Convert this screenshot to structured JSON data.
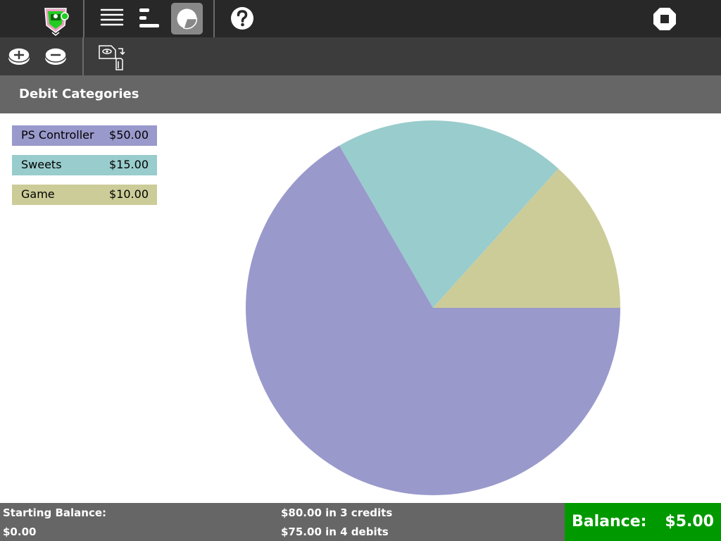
{
  "toolbar": {
    "icons": [
      "activity-icon",
      "list-view-icon",
      "bar-chart-icon",
      "pie-chart-icon",
      "help-icon",
      "stop-icon"
    ],
    "active": "pie-chart-icon"
  },
  "subbar": {
    "icons": [
      "add-credit-icon",
      "add-debit-icon",
      "view-copy-icon"
    ]
  },
  "header": {
    "title": "Debit Categories"
  },
  "colors": {
    "toolbar": "#282828",
    "subbar": "#3c3c3c",
    "header": "#666666",
    "balance": "#009900"
  },
  "chart_data": {
    "type": "pie",
    "categories": [
      "PS Controller",
      "Sweets",
      "Game"
    ],
    "values": [
      50,
      15,
      10
    ],
    "labels": [
      "$50.00",
      "$15.00",
      "$10.00"
    ],
    "colors": [
      "#9999cc",
      "#99cccc",
      "#cccc99"
    ],
    "legend": "left"
  },
  "footer": {
    "starting_label": "Starting Balance:",
    "starting_value": "$0.00",
    "credits_text": "$80.00 in 3 credits",
    "debits_text": "$75.00 in 4 debits",
    "balance_label": "Balance:",
    "balance_value": "$5.00"
  }
}
